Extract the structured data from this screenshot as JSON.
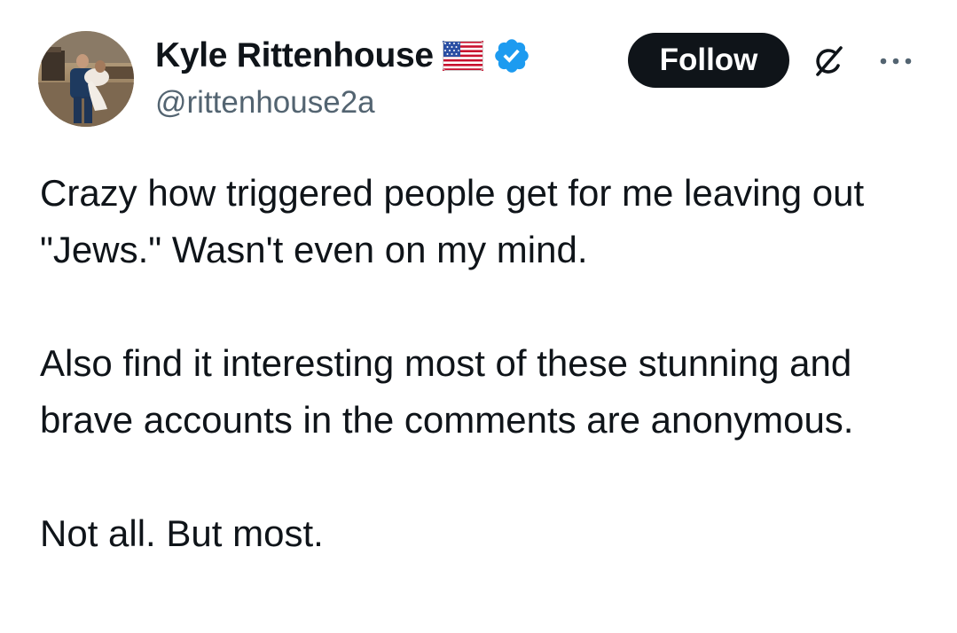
{
  "author": {
    "display_name": "Kyle Rittenhouse",
    "handle": "@rittenhouse2a",
    "flag_icon": "us-flag-icon",
    "verified_icon": "verified-badge-icon",
    "verified_color": "#1d9bf0",
    "avatar_icon": "profile-photo-avatar"
  },
  "actions": {
    "follow_label": "Follow",
    "grok_icon": "grok-icon",
    "more_icon": "more-options-icon"
  },
  "tweet": {
    "paragraphs": [
      "Crazy how triggered people get for me leaving out \"Jews.\" Wasn't even on my mind.",
      "Also find it interesting most of these stunning and brave accounts in the comments are anonymous.",
      "Not all. But most."
    ]
  },
  "colors": {
    "text": "#0f1419",
    "secondary_text": "#536471",
    "button_bg": "#0f1419",
    "button_text": "#ffffff"
  }
}
